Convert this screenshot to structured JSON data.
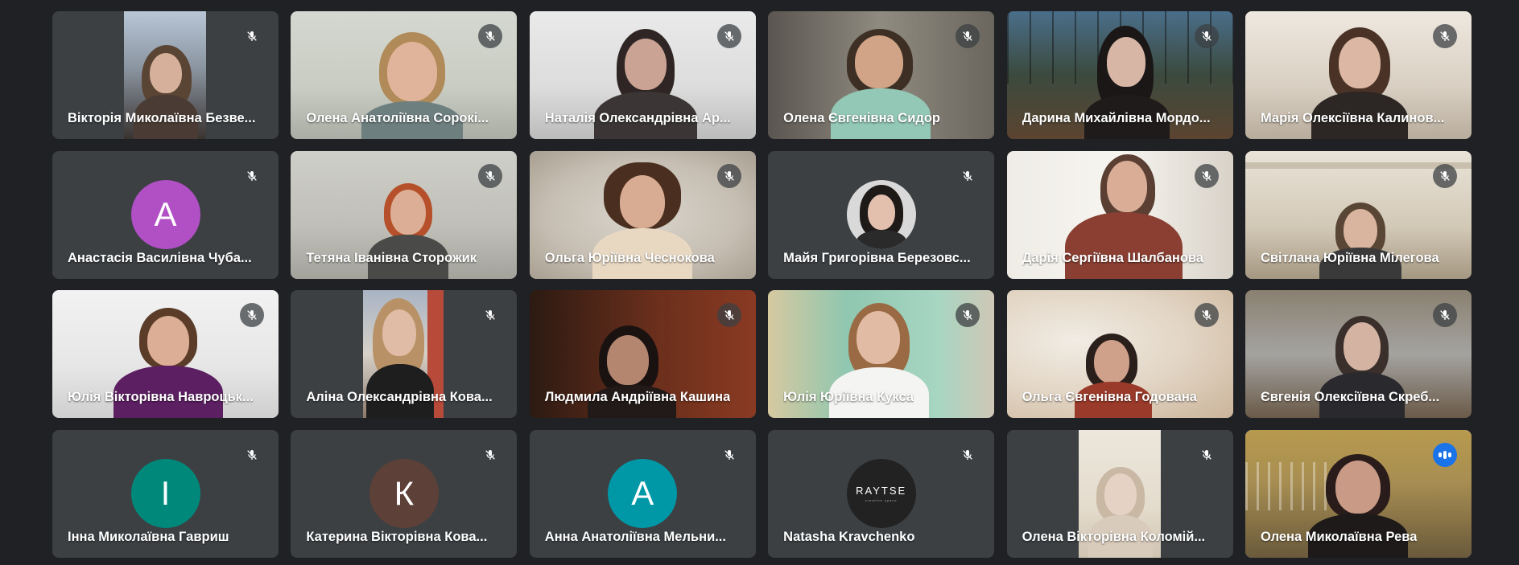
{
  "participants": [
    {
      "name": "Вікторія Миколаївна Безвершенко",
      "display_name": "Вікторія Миколаївна Безве...",
      "muted": true,
      "kind": "video"
    },
    {
      "name": "Олена Анатоліївна Сорокіна",
      "display_name": "Олена Анатоліївна Сорокі...",
      "muted": true,
      "kind": "video"
    },
    {
      "name": "Наталія Олександрівна Ар",
      "display_name": "Наталія Олександрівна Ар...",
      "muted": true,
      "kind": "video"
    },
    {
      "name": "Олена Євгенівна Сидор",
      "display_name": "Олена Євгенівна Сидор",
      "muted": true,
      "kind": "video"
    },
    {
      "name": "Дарина Михайлівна Мордо",
      "display_name": "Дарина Михайлівна Мордо...",
      "muted": true,
      "kind": "video"
    },
    {
      "name": "Марія Олексіївна Калинов",
      "display_name": "Марія Олексіївна Калинов...",
      "muted": true,
      "kind": "video"
    },
    {
      "name": "Анастасія Василівна Чуба",
      "display_name": "Анастасія Василівна Чуба...",
      "muted": true,
      "kind": "avatar",
      "initial": "А",
      "avatar_color": "#b14fc5"
    },
    {
      "name": "Тетяна Іванівна Сторожик",
      "display_name": "Тетяна Іванівна Сторожик",
      "muted": true,
      "kind": "video"
    },
    {
      "name": "Ольга Юріївна Чеснокова",
      "display_name": "Ольга Юріївна Чеснокова",
      "muted": true,
      "kind": "video"
    },
    {
      "name": "Майя Григорівна Березовс",
      "display_name": "Майя Григорівна Березовс...",
      "muted": true,
      "kind": "photo-avatar"
    },
    {
      "name": "Дарія Сергіївна Шалбанова",
      "display_name": "Дарія Сергіївна Шалбанова",
      "muted": true,
      "kind": "video"
    },
    {
      "name": "Світлана Юріївна Мілегова",
      "display_name": "Світлана Юріївна Мілегова",
      "muted": true,
      "kind": "video"
    },
    {
      "name": "Юлія Вікторівна Навроцьк",
      "display_name": "Юлія Вікторівна Навроцьк...",
      "muted": true,
      "kind": "video"
    },
    {
      "name": "Аліна Олександрівна Кова",
      "display_name": "Аліна Олександрівна Кова...",
      "muted": true,
      "kind": "video"
    },
    {
      "name": "Людмила Андріївна Кашина",
      "display_name": "Людмила Андріївна Кашина",
      "muted": true,
      "kind": "video"
    },
    {
      "name": "Юлія Юріївна Кукса",
      "display_name": "Юлія Юріївна Кукса",
      "muted": true,
      "kind": "video"
    },
    {
      "name": "Ольга Євгенівна Годована",
      "display_name": "Ольга Євгенівна Годована",
      "muted": true,
      "kind": "video"
    },
    {
      "name": "Євгенія Олексіївна Скреб",
      "display_name": "Євгенія Олексіївна Скреб...",
      "muted": true,
      "kind": "video"
    },
    {
      "name": "Інна Миколаївна Гавриш",
      "display_name": "Інна Миколаївна Гавриш",
      "muted": true,
      "kind": "avatar",
      "initial": "І",
      "avatar_color": "#00897b"
    },
    {
      "name": "Катерина Вікторівна Кова",
      "display_name": "Катерина Вікторівна Кова...",
      "muted": true,
      "kind": "avatar",
      "initial": "К",
      "avatar_color": "#5d4037"
    },
    {
      "name": "Анна Анатоліївна Мельни",
      "display_name": "Анна Анатоліївна Мельни...",
      "muted": true,
      "kind": "avatar",
      "initial": "А",
      "avatar_color": "#0097a7"
    },
    {
      "name": "Natasha Kravchenko",
      "display_name": "Natasha Kravchenko",
      "muted": true,
      "kind": "logo-avatar",
      "logo_text": "RAYTSE",
      "logo_sub": "creative space"
    },
    {
      "name": "Олена Вікторівна Коломій",
      "display_name": "Олена Вікторівна Коломій...",
      "muted": true,
      "kind": "video"
    },
    {
      "name": "Олена Миколаївна Рева",
      "display_name": "Олена Миколаївна Рева",
      "muted": false,
      "speaking": true,
      "kind": "video"
    }
  ],
  "icons": {
    "muted": "mic-off-icon",
    "speaking": "audio-level-icon"
  },
  "colors": {
    "background": "#202124",
    "tile": "#3c4043",
    "active_outline": "#8ab4f8",
    "speaking_badge": "#1a73e8"
  }
}
